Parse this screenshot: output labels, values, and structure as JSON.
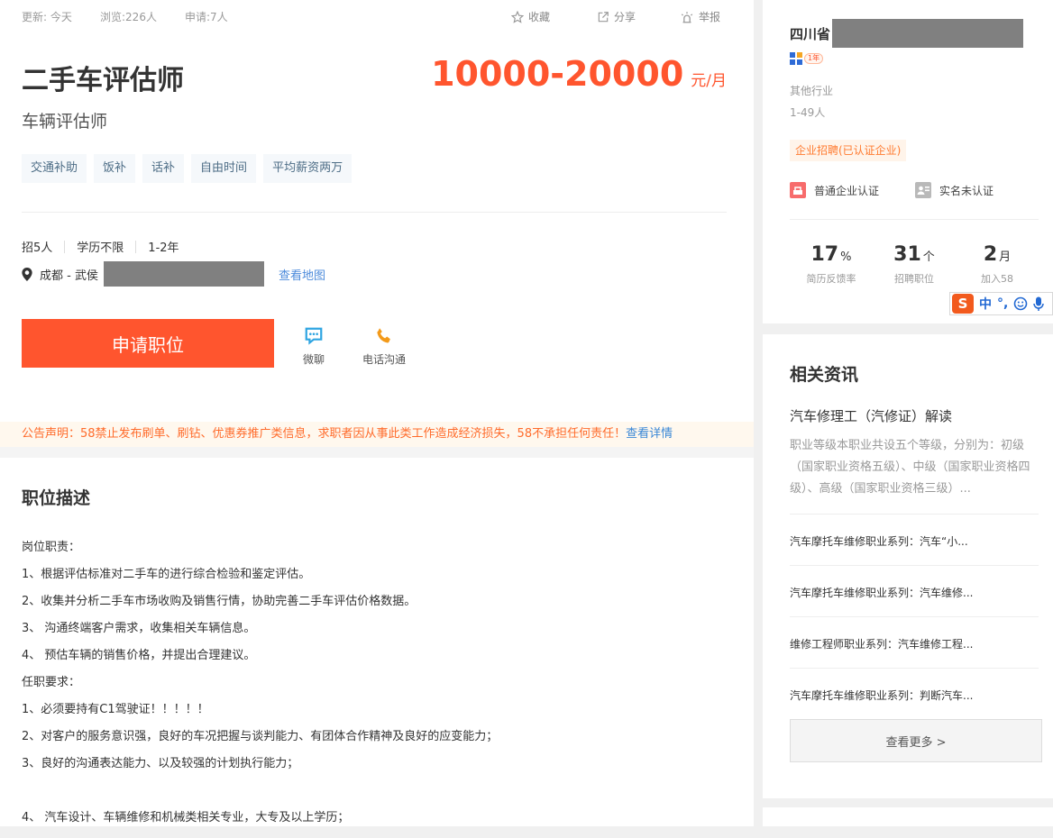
{
  "header": {
    "update": "更新: 今天",
    "views": "浏览:226人",
    "applies": "申请:7人",
    "collect": "收藏",
    "share": "分享",
    "report": "举报"
  },
  "job": {
    "title": "二手车评估师",
    "subtitle": "车辆评估师",
    "salary": "10000-20000",
    "salary_unit": "元/月",
    "tags": [
      "交通补助",
      "饭补",
      "话补",
      "自由时间",
      "平均薪资两万"
    ],
    "requirements": [
      "招5人",
      "学历不限",
      "1-2年"
    ],
    "location": "成都 - 武侯",
    "map_link": "查看地图",
    "apply_label": "申请职位",
    "chat_label": "微聊",
    "phone_label": "电话沟通"
  },
  "notice": {
    "text": "公告声明：58禁止发布刷单、刷钻、优惠券推广类信息，求职者因从事此类工作造成经济损失，58不承担任何责任！",
    "link": "查看详情"
  },
  "description": {
    "title": "职位描述",
    "lines": [
      "岗位职责：",
      "1、根据评估标准对二手车的进行综合检验和鉴定评估。",
      "2、收集并分析二手车市场收购及销售行情，协助完善二手车评估价格数据。",
      "3、 沟通终端客户需求，收集相关车辆信息。",
      "4、 预估车辆的销售价格，并提出合理建议。",
      "任职要求：",
      "1、必须要持有C1驾驶证！！！！！",
      "2、对客户的服务意识强，良好的车况把握与谈判能力、有团体合作精神及良好的应变能力；",
      "3、良好的沟通表达能力、以及较强的计划执行能力；",
      "",
      "4、 汽车设计、车辆维修和机械类相关专业，大专及以上学历；"
    ]
  },
  "company": {
    "name": "四川省",
    "years": "1年",
    "industry": "其他行业",
    "size": "1-49人",
    "tag": "企业招聘(已认证企业)",
    "cert1": "普通企业认证",
    "cert2": "实名未认证",
    "stats": [
      {
        "value": "17",
        "unit": "%",
        "label": "简历反馈率"
      },
      {
        "value": "31",
        "unit": "个",
        "label": "招聘职位"
      },
      {
        "value": "2",
        "unit": "月",
        "label": "加入58"
      }
    ]
  },
  "ime": {
    "logo": "S",
    "mode": "中",
    "punct": "°,"
  },
  "news": {
    "title": "相关资讯",
    "headline": "汽车修理工（汽修证）解读",
    "summary": "职业等级本职业共设五个等级，分别为：初级（国家职业资格五级）、中级（国家职业资格四级）、高级（国家职业资格三级）...",
    "items": [
      "汽车摩托车维修职业系列：汽车“小...",
      "汽车摩托车维修职业系列：汽车维修...",
      "维修工程师职业系列：汽车维修工程...",
      "汽车摩托车维修职业系列：判断汽车..."
    ],
    "more": "查看更多 >"
  },
  "colors": {
    "accent": "#ff552e",
    "link": "#4d8bdb"
  }
}
